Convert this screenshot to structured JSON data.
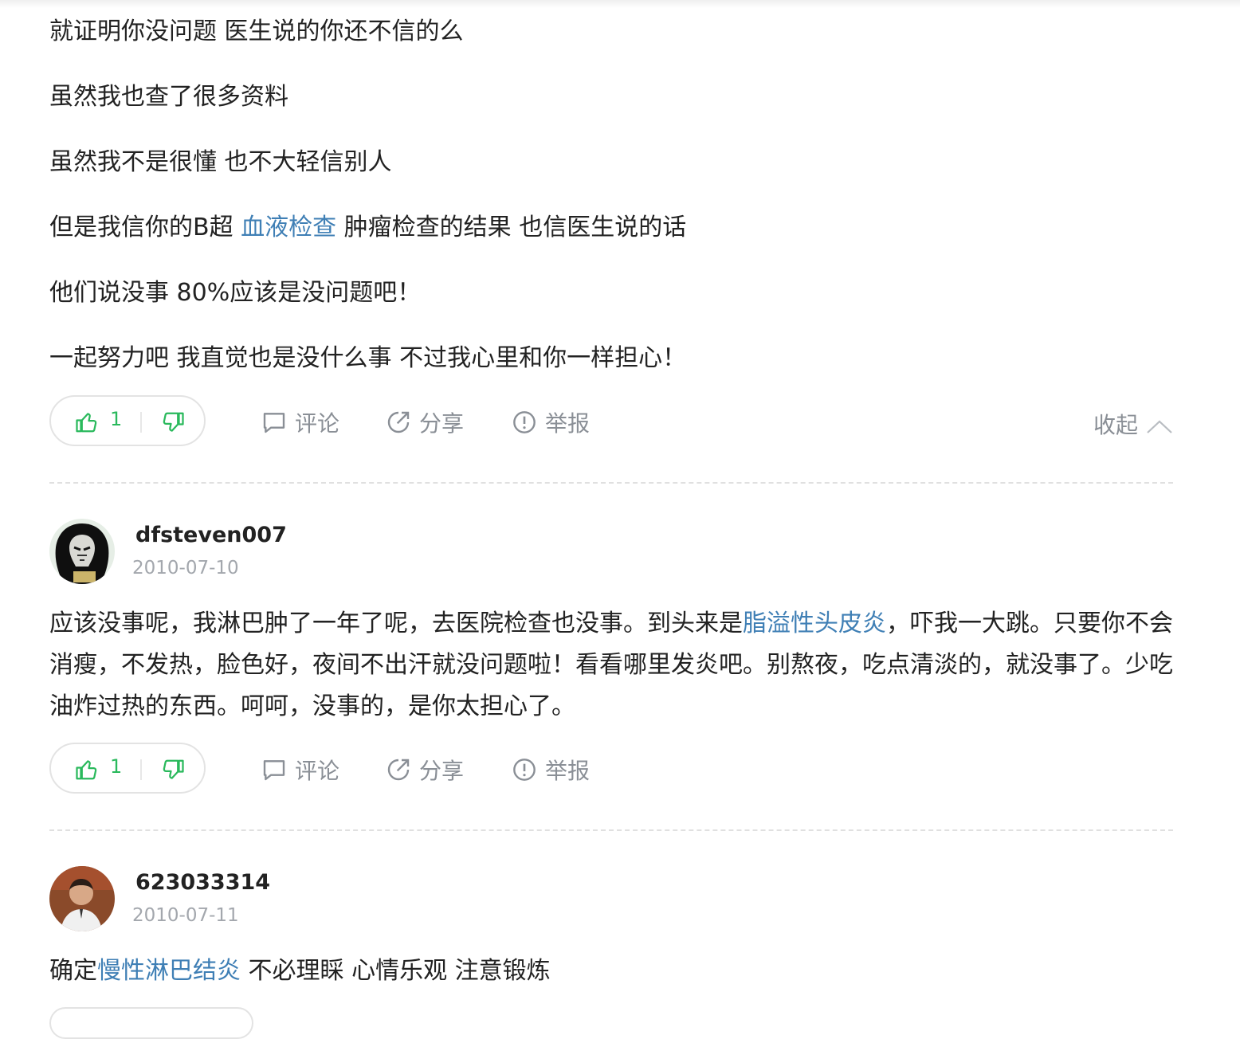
{
  "answer_tail": {
    "paragraphs": [
      {
        "segments": [
          {
            "text": "就证明你没问题 医生说的你还不信的么"
          }
        ]
      },
      {
        "segments": [
          {
            "text": "虽然我也查了很多资料"
          }
        ]
      },
      {
        "segments": [
          {
            "text": "虽然我不是很懂 也不大轻信别人"
          }
        ]
      },
      {
        "segments": [
          {
            "text": "但是我信你的B超 "
          },
          {
            "text": "血液检查",
            "link": true
          },
          {
            "text": " 肿瘤检查的结果 也信医生说的话"
          }
        ]
      },
      {
        "segments": [
          {
            "text": "他们说没事 80%应该是没问题吧！"
          }
        ]
      },
      {
        "segments": [
          {
            "text": "一起努力吧 我直觉也是没什么事 不过我心里和你一样担心！"
          }
        ]
      }
    ],
    "actions": {
      "like_count": "1",
      "comment": "评论",
      "share": "分享",
      "report": "举报",
      "collapse": "收起"
    }
  },
  "answers": [
    {
      "username": "dfsteven007",
      "date": "2010-07-10",
      "avatar_icon": "masked-figure-avatar",
      "segments": [
        {
          "text": "应该没事呢，我淋巴肿了一年了呢，去医院检查也没事。到头来是"
        },
        {
          "text": "脂溢性头皮炎",
          "link": true
        },
        {
          "text": "，吓我一大跳。只要你不会消瘦，不发热，脸色好，夜间不出汗就没问题啦！看看哪里发炎吧。别熬夜，吃点清淡的，就没事了。少吃油炸过热的东西。呵呵，没事的，是你太担心了。"
        }
      ],
      "actions": {
        "like_count": "1",
        "comment": "评论",
        "share": "分享",
        "report": "举报"
      }
    },
    {
      "username": "623033314",
      "date": "2010-07-11",
      "avatar_icon": "man-portrait-avatar",
      "segments": [
        {
          "text": "确定"
        },
        {
          "text": "慢性淋巴结炎",
          "link": true
        },
        {
          "text": " 不必理睬 心情乐观 注意锻炼"
        }
      ]
    }
  ],
  "colors": {
    "link": "#3f7fb5",
    "like_green": "#2ab95c",
    "muted": "#8a8f96",
    "date": "#a3a7ad"
  }
}
